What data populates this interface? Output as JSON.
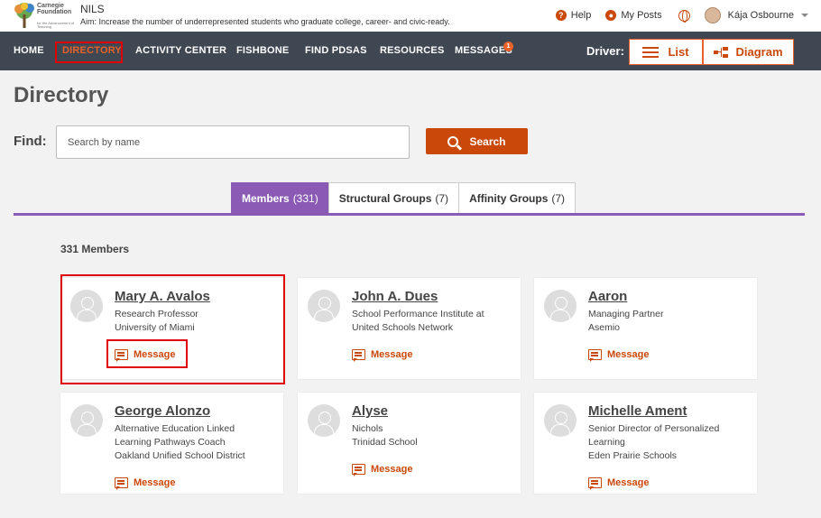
{
  "header": {
    "logo": {
      "org_line1": "Carnegie Foundation",
      "org_line2": "for the Advancement of Teaching"
    },
    "app_name": "NILS",
    "aim": "Aim:  Increase the number of underrepresented students who graduate college, career- and civic-ready.",
    "links": {
      "help": "Help",
      "my_posts": "My Posts",
      "user_name": "Kája Osbourne"
    }
  },
  "nav": {
    "items": [
      "HOME",
      "DIRECTORY",
      "ACTIVITY CENTER",
      "FISHBONE",
      "FIND PDSAS",
      "RESOURCES",
      "MESSAGES"
    ],
    "active": "DIRECTORY",
    "messages_badge": "1",
    "driver_label": "Driver:",
    "driver_list": "List",
    "driver_diagram": "Diagram"
  },
  "page": {
    "title": "Directory",
    "find_label": "Find:",
    "search_placeholder": "Search by name",
    "search_button": "Search"
  },
  "tabs": [
    {
      "label": "Members",
      "count": "(331)",
      "active": true
    },
    {
      "label": "Structural Groups",
      "count": "(7)",
      "active": false
    },
    {
      "label": "Affinity Groups",
      "count": "(7)",
      "active": false
    }
  ],
  "member_count": "331 Members",
  "members": [
    {
      "name": "Mary A. Avalos",
      "lines": [
        "Research Professor",
        "University of Miami"
      ],
      "message": "Message"
    },
    {
      "name": "John A. Dues",
      "lines": [
        "School Performance Institute at",
        "United Schools Network"
      ],
      "message": "Message"
    },
    {
      "name": "Aaron",
      "lines": [
        "Managing Partner",
        "Asemio"
      ],
      "message": "Message"
    },
    {
      "name": "George Alonzo",
      "lines": [
        "Alternative Education Linked",
        "Learning Pathways Coach",
        "Oakland Unified School District"
      ],
      "message": "Message"
    },
    {
      "name": "Alyse",
      "lines": [
        "Nichols",
        "Trinidad School"
      ],
      "message": "Message"
    },
    {
      "name": "Michelle Ament",
      "lines": [
        "Senior Director of Personalized",
        "Learning",
        "Eden Prairie Schools"
      ],
      "message": "Message"
    }
  ],
  "colors": {
    "accent": "#c9480a",
    "nav_bg": "#3f4752",
    "tab_active": "#8a5ab5",
    "highlight": "#e00000"
  }
}
